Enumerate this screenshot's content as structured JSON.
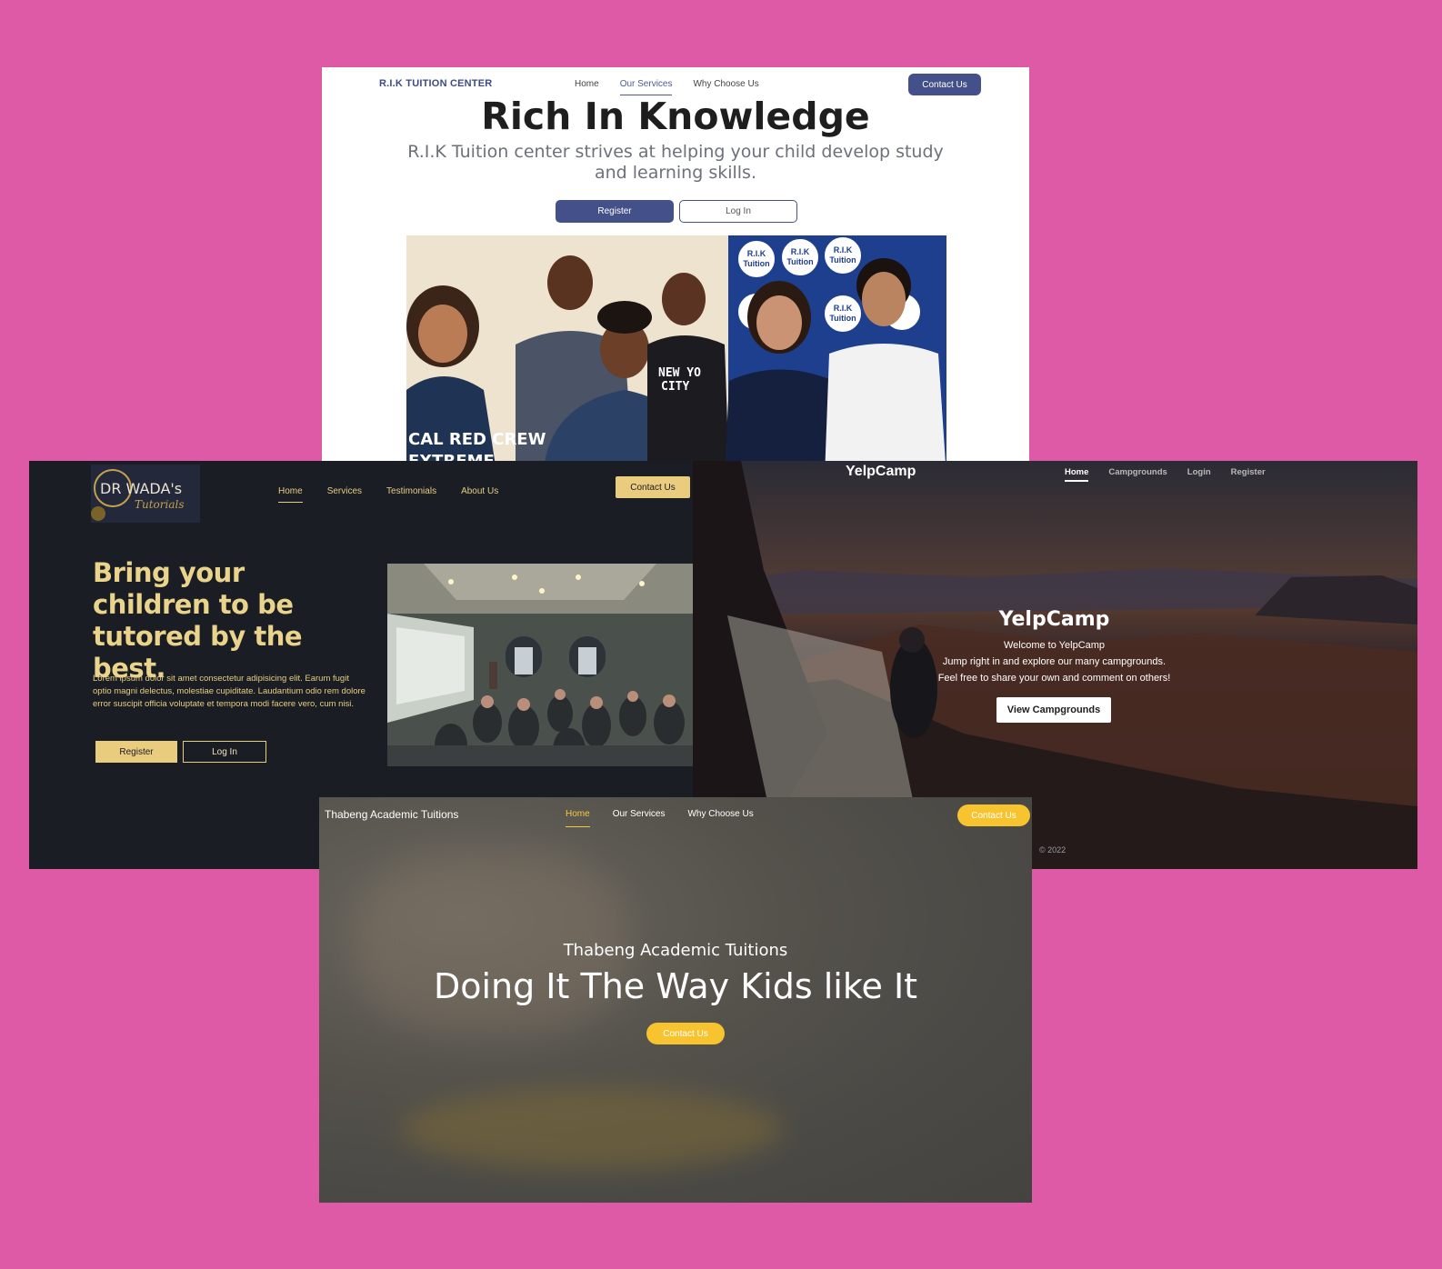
{
  "rik": {
    "brand": "R.I.K TUITION CENTER",
    "nav": [
      "Home",
      "Our Services",
      "Why Choose Us"
    ],
    "contact": "Contact Us",
    "headline": "Rich In Knowledge",
    "subtitle": "R.I.K Tuition center strives at helping your child develop study and learning skills.",
    "register": "Register",
    "login": "Log In",
    "banner_text": [
      "R.I.K",
      "Tuition",
      "R.I.K",
      "Tuition",
      "R.I.K",
      "Tuition",
      "R.I.K",
      "Tuition"
    ],
    "shirt_text": [
      "CAL RED CREW",
      "EXTREME",
      "NEW YO",
      "CITY"
    ]
  },
  "wada": {
    "logo_text": "DR WADA's",
    "logo_script": "Tutorials",
    "nav": [
      "Home",
      "Services",
      "Testimonials",
      "About Us"
    ],
    "contact": "Contact Us",
    "headline": "Bring your children to be tutored by the best.",
    "body": "Lorem ipsum dolor sit amet consectetur adipisicing elit. Earum fugit optio magni delectus, molestiae cupiditate. Laudantium odio rem dolore error suscipit officia voluptate et tempora modi facere vero, cum nisi.",
    "register": "Register",
    "login": "Log In"
  },
  "yelp": {
    "brand": "YelpCamp",
    "nav": [
      "Home",
      "Campgrounds",
      "Login",
      "Register"
    ],
    "title": "YelpCamp",
    "lines": [
      "Welcome to YelpCamp",
      "Jump right in and explore our many campgrounds.",
      "Feel free to share your own and comment on others!"
    ],
    "button": "View Campgrounds",
    "footer": "© 2022"
  },
  "thab": {
    "brand": "Thabeng Academic Tuitions",
    "nav": [
      "Home",
      "Our Services",
      "Why Choose Us"
    ],
    "contact": "Contact Us",
    "small": "Thabeng Academic Tuitions",
    "big": "Doing It The Way Kids like It",
    "button": "Contact Us"
  }
}
